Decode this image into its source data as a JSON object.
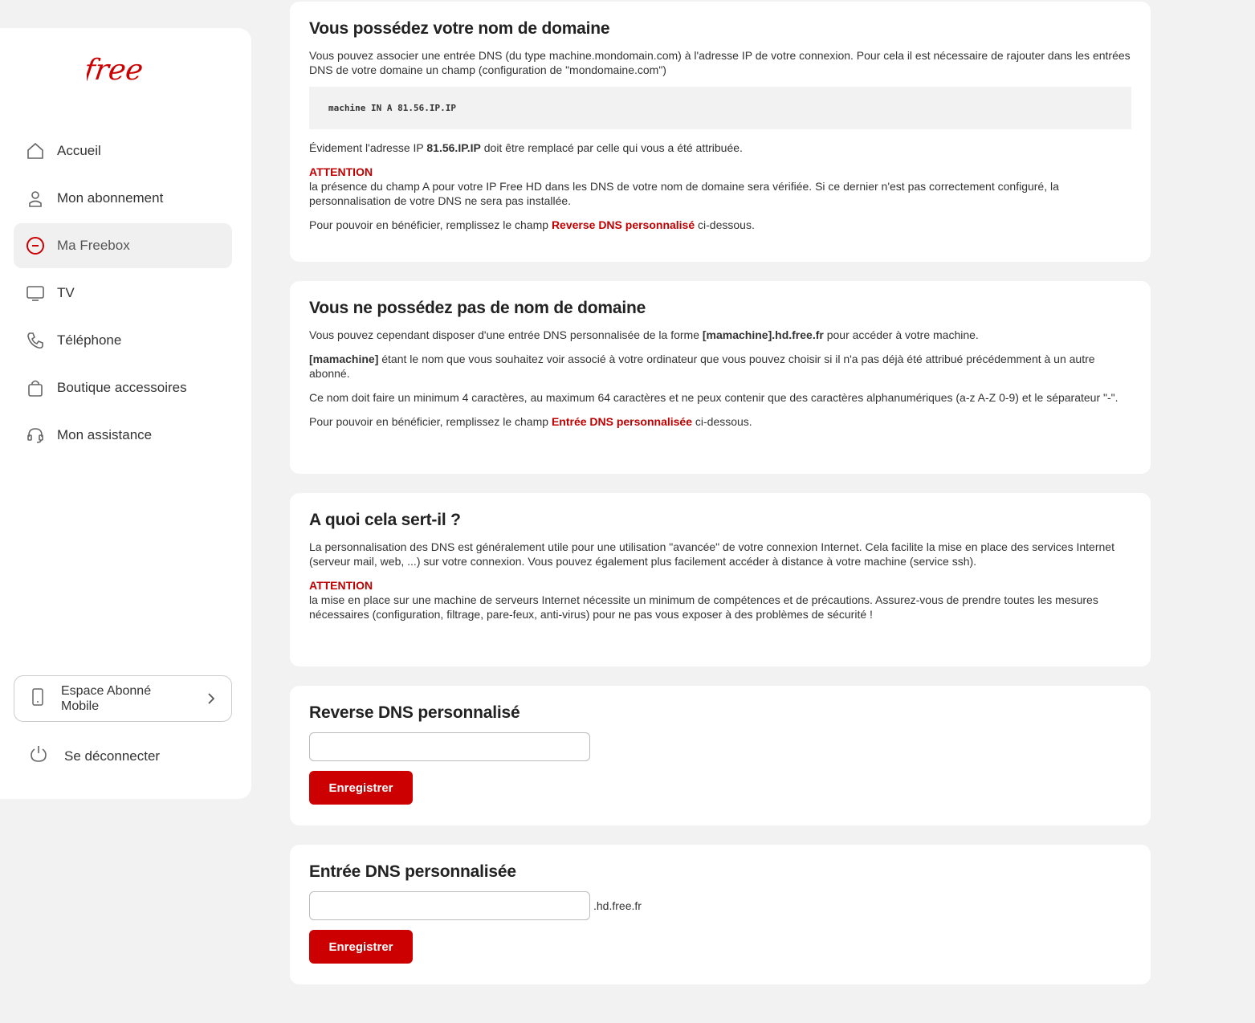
{
  "brand": {
    "logo_text": "free",
    "accent": "#cc0000"
  },
  "sidebar": {
    "items": [
      {
        "label": "Accueil",
        "icon": "home-icon"
      },
      {
        "label": "Mon abonnement",
        "icon": "user-icon"
      },
      {
        "label": "Ma Freebox",
        "icon": "freebox-icon",
        "active": true
      },
      {
        "label": "TV",
        "icon": "tv-icon"
      },
      {
        "label": "Téléphone",
        "icon": "phone-icon"
      },
      {
        "label": "Boutique accessoires",
        "icon": "shopping-bag-icon"
      },
      {
        "label": "Mon assistance",
        "icon": "headset-icon"
      }
    ],
    "mobile_label": "Espace Abonné Mobile",
    "logout_label": "Se déconnecter"
  },
  "card1": {
    "title": "Vous possédez votre nom de domaine",
    "p1": "Vous pouvez associer une entrée DNS (du type machine.mondomain.com) à l'adresse IP de votre connexion. Pour cela il est nécessaire de rajouter dans les entrées DNS de votre domaine un champ (configuration de \"mondomaine.com\")",
    "code": "machine IN A 81.56.IP.IP",
    "p2_a": "Évidement l'adresse IP ",
    "p2_b": "81.56.IP.IP",
    "p2_c": " doit être remplacé par celle qui vous a été attribuée.",
    "att_label": "ATTENTION",
    "att_text": "la présence du champ A pour votre IP Free HD dans les DNS de votre nom de domaine sera vérifiée. Si ce dernier n'est pas correctement configuré, la personnalisation de votre DNS ne sera pas installée.",
    "p3_a": "Pour pouvoir en bénéficier, remplissez le champ ",
    "p3_b": "Reverse DNS personnalisé",
    "p3_c": " ci-dessous."
  },
  "card2": {
    "title": "Vous ne possédez pas de nom de domaine",
    "p1_a": "Vous pouvez cependant disposer d'une entrée DNS personnalisée de la forme ",
    "p1_b": "[mamachine].hd.free.fr",
    "p1_c": " pour accéder à votre machine.",
    "p2_a": "[mamachine]",
    "p2_b": " étant le nom que vous souhaitez voir associé à votre ordinateur que vous pouvez choisir si il n'a pas déjà été attribué précédemment à un autre abonné.",
    "p3": "Ce nom doit faire un minimum 4 caractères, au maximum 64 caractères et ne peux contenir que des caractères alphanumériques (a-z A-Z 0-9) et le séparateur \"-\".",
    "p4_a": "Pour pouvoir en bénéficier, remplissez le champ ",
    "p4_b": "Entrée DNS personnalisée",
    "p4_c": " ci-dessous."
  },
  "card3": {
    "title": "A quoi cela sert-il ?",
    "p1": "La personnalisation des DNS est généralement utile pour une utilisation \"avancée\" de votre connexion Internet. Cela facilite la mise en place des services Internet (serveur mail, web, ...) sur votre connexion. Vous pouvez également plus facilement accéder à distance à votre machine (service ssh).",
    "att_label": "ATTENTION",
    "att_text": "la mise en place sur une machine de serveurs Internet nécessite un minimum de compétences et de précautions. Assurez-vous de prendre toutes les mesures nécessaires (configuration, filtrage, pare-feux, anti-virus) pour ne pas vous exposer à des problèmes de sécurité !"
  },
  "reverse_form": {
    "title": "Reverse DNS personnalisé",
    "value": "",
    "button": "Enregistrer"
  },
  "dns_form": {
    "title": "Entrée DNS personnalisée",
    "value": "",
    "suffix": ".hd.free.fr",
    "button": "Enregistrer"
  }
}
